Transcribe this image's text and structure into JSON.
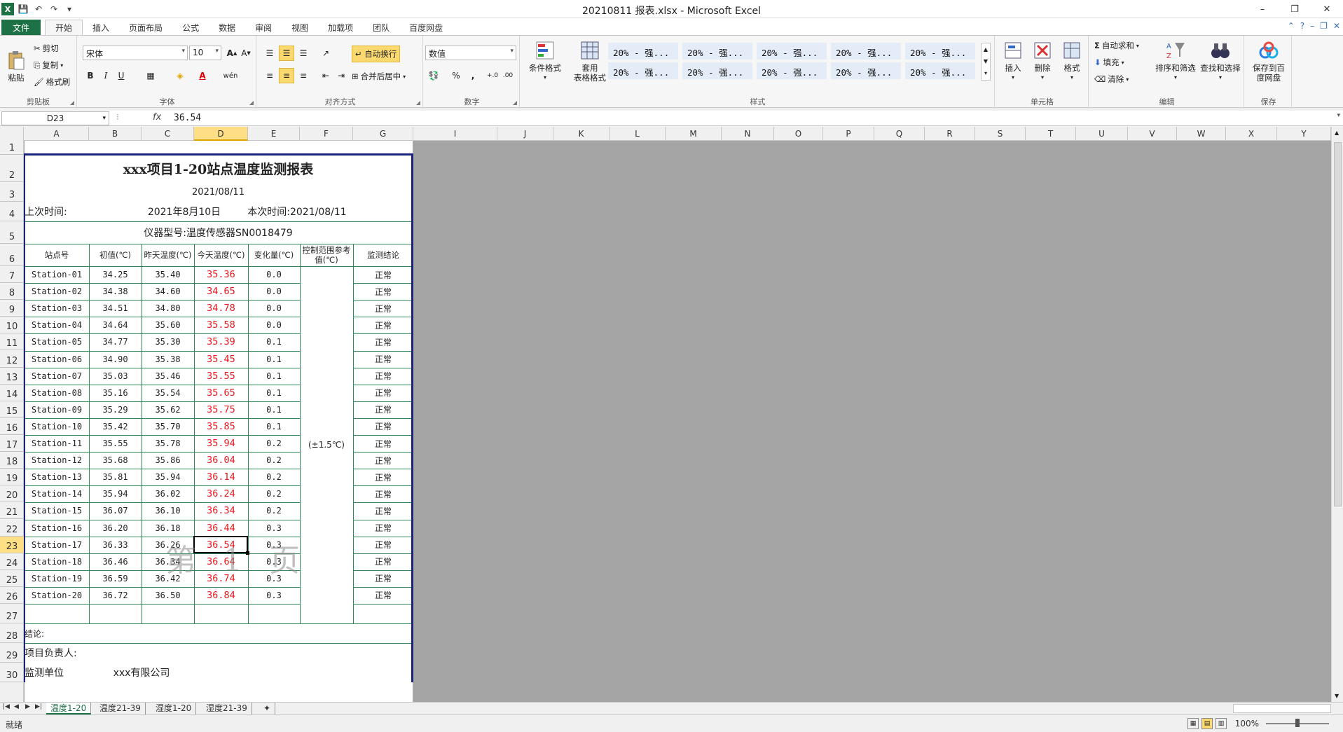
{
  "app": {
    "title": "20210811 报表.xlsx - Microsoft Excel",
    "window_controls": [
      "–",
      "❐",
      "✕"
    ]
  },
  "tabs": {
    "items": [
      "文件",
      "开始",
      "插入",
      "页面布局",
      "公式",
      "数据",
      "审阅",
      "视图",
      "加载项",
      "团队",
      "百度网盘"
    ],
    "active": "开始"
  },
  "ribbon": {
    "clipboard": {
      "label": "剪贴板",
      "paste": "粘贴",
      "cut": "剪切",
      "copy": "复制",
      "format_painter": "格式刷"
    },
    "font": {
      "label": "字体",
      "name": "宋体",
      "size": "10",
      "bold": "B",
      "italic": "I",
      "underline": "U",
      "phonetic": "wén"
    },
    "alignment": {
      "label": "对齐方式",
      "wrap": "自动换行",
      "merge": "合并后居中"
    },
    "number": {
      "label": "数字",
      "format": "数值",
      "percent": "%",
      "comma": ","
    },
    "styles": {
      "label": "样式",
      "conditional": "条件格式",
      "table_format_1": "套用",
      "table_format_2": "表格格式",
      "cells": [
        "20% - 强...",
        "20% - 强...",
        "20% - 强...",
        "20% - 强...",
        "20% - 强...",
        "20% - 强...",
        "20% - 强...",
        "20% - 强...",
        "20% - 强...",
        "20% - 强..."
      ]
    },
    "cells_group": {
      "label": "单元格",
      "insert": "插入",
      "delete": "删除",
      "format": "格式"
    },
    "editing": {
      "label": "编辑",
      "autosum": "自动求和",
      "fill": "填充",
      "clear": "清除",
      "sort": "排序和筛选",
      "find": "查找和选择"
    },
    "save": {
      "label": "保存",
      "save_baidu_1": "保存到百",
      "save_baidu_2": "度网盘"
    }
  },
  "formula_bar": {
    "name_box": "D23",
    "fx": "fx",
    "value": "36.54"
  },
  "columns": [
    "A",
    "B",
    "C",
    "D",
    "E",
    "F",
    "G",
    "I",
    "J",
    "K",
    "L",
    "M",
    "N",
    "O",
    "P",
    "Q",
    "R",
    "S",
    "T",
    "U",
    "V",
    "W",
    "X",
    "Y"
  ],
  "rows": [
    "1",
    "2",
    "3",
    "4",
    "5",
    "6",
    "7",
    "8",
    "9",
    "10",
    "11",
    "12",
    "13",
    "14",
    "15",
    "16",
    "17",
    "18",
    "19",
    "20",
    "21",
    "22",
    "23",
    "24",
    "25",
    "26",
    "27",
    "28",
    "29",
    "30"
  ],
  "report": {
    "title": "xxx项目1-20站点温度监测报表",
    "date": "2021/08/11",
    "last_time_label": "上次时间:",
    "last_time_value": "2021年8月10日",
    "this_time": "本次时间:2021/08/11",
    "instrument": "仪器型号:温度传感器SN0018479",
    "headers": [
      "站点号",
      "初值(℃)",
      "昨天温度(℃)",
      "今天温度(℃)",
      "变化量(℃)",
      "控制范围参考值(℃)",
      "监测结论"
    ],
    "control_range": "(±1.5℃)",
    "rows": [
      [
        "Station-01",
        "34.25",
        "35.40",
        "35.36",
        "0.0",
        "正常"
      ],
      [
        "Station-02",
        "34.38",
        "34.60",
        "34.65",
        "0.0",
        "正常"
      ],
      [
        "Station-03",
        "34.51",
        "34.80",
        "34.78",
        "0.0",
        "正常"
      ],
      [
        "Station-04",
        "34.64",
        "35.60",
        "35.58",
        "0.0",
        "正常"
      ],
      [
        "Station-05",
        "34.77",
        "35.30",
        "35.39",
        "0.1",
        "正常"
      ],
      [
        "Station-06",
        "34.90",
        "35.38",
        "35.45",
        "0.1",
        "正常"
      ],
      [
        "Station-07",
        "35.03",
        "35.46",
        "35.55",
        "0.1",
        "正常"
      ],
      [
        "Station-08",
        "35.16",
        "35.54",
        "35.65",
        "0.1",
        "正常"
      ],
      [
        "Station-09",
        "35.29",
        "35.62",
        "35.75",
        "0.1",
        "正常"
      ],
      [
        "Station-10",
        "35.42",
        "35.70",
        "35.85",
        "0.1",
        "正常"
      ],
      [
        "Station-11",
        "35.55",
        "35.78",
        "35.94",
        "0.2",
        "正常"
      ],
      [
        "Station-12",
        "35.68",
        "35.86",
        "36.04",
        "0.2",
        "正常"
      ],
      [
        "Station-13",
        "35.81",
        "35.94",
        "36.14",
        "0.2",
        "正常"
      ],
      [
        "Station-14",
        "35.94",
        "36.02",
        "36.24",
        "0.2",
        "正常"
      ],
      [
        "Station-15",
        "36.07",
        "36.10",
        "36.34",
        "0.2",
        "正常"
      ],
      [
        "Station-16",
        "36.20",
        "36.18",
        "36.44",
        "0.3",
        "正常"
      ],
      [
        "Station-17",
        "36.33",
        "36.26",
        "36.54",
        "0.3",
        "正常"
      ],
      [
        "Station-18",
        "36.46",
        "36.34",
        "36.64",
        "0.3",
        "正常"
      ],
      [
        "Station-19",
        "36.59",
        "36.42",
        "36.74",
        "0.3",
        "正常"
      ],
      [
        "Station-20",
        "36.72",
        "36.50",
        "36.84",
        "0.3",
        "正常"
      ]
    ],
    "conclusion_label": "结论:",
    "manager_label": "项目负责人:",
    "unit_label": "监测单位",
    "unit_value": "xxx有限公司",
    "watermark": "第 1 页"
  },
  "sheet_tabs": [
    "温度1-20",
    "温度21-39",
    "湿度1-20",
    "湿度21-39"
  ],
  "active_sheet": "温度1-20",
  "status": {
    "text": "就绪",
    "zoom": "100%"
  },
  "colors": {
    "accent": "#1e7145",
    "grid_line": "#2e8b57",
    "today_value": "#e8161c",
    "selection": "#ffdf85"
  }
}
